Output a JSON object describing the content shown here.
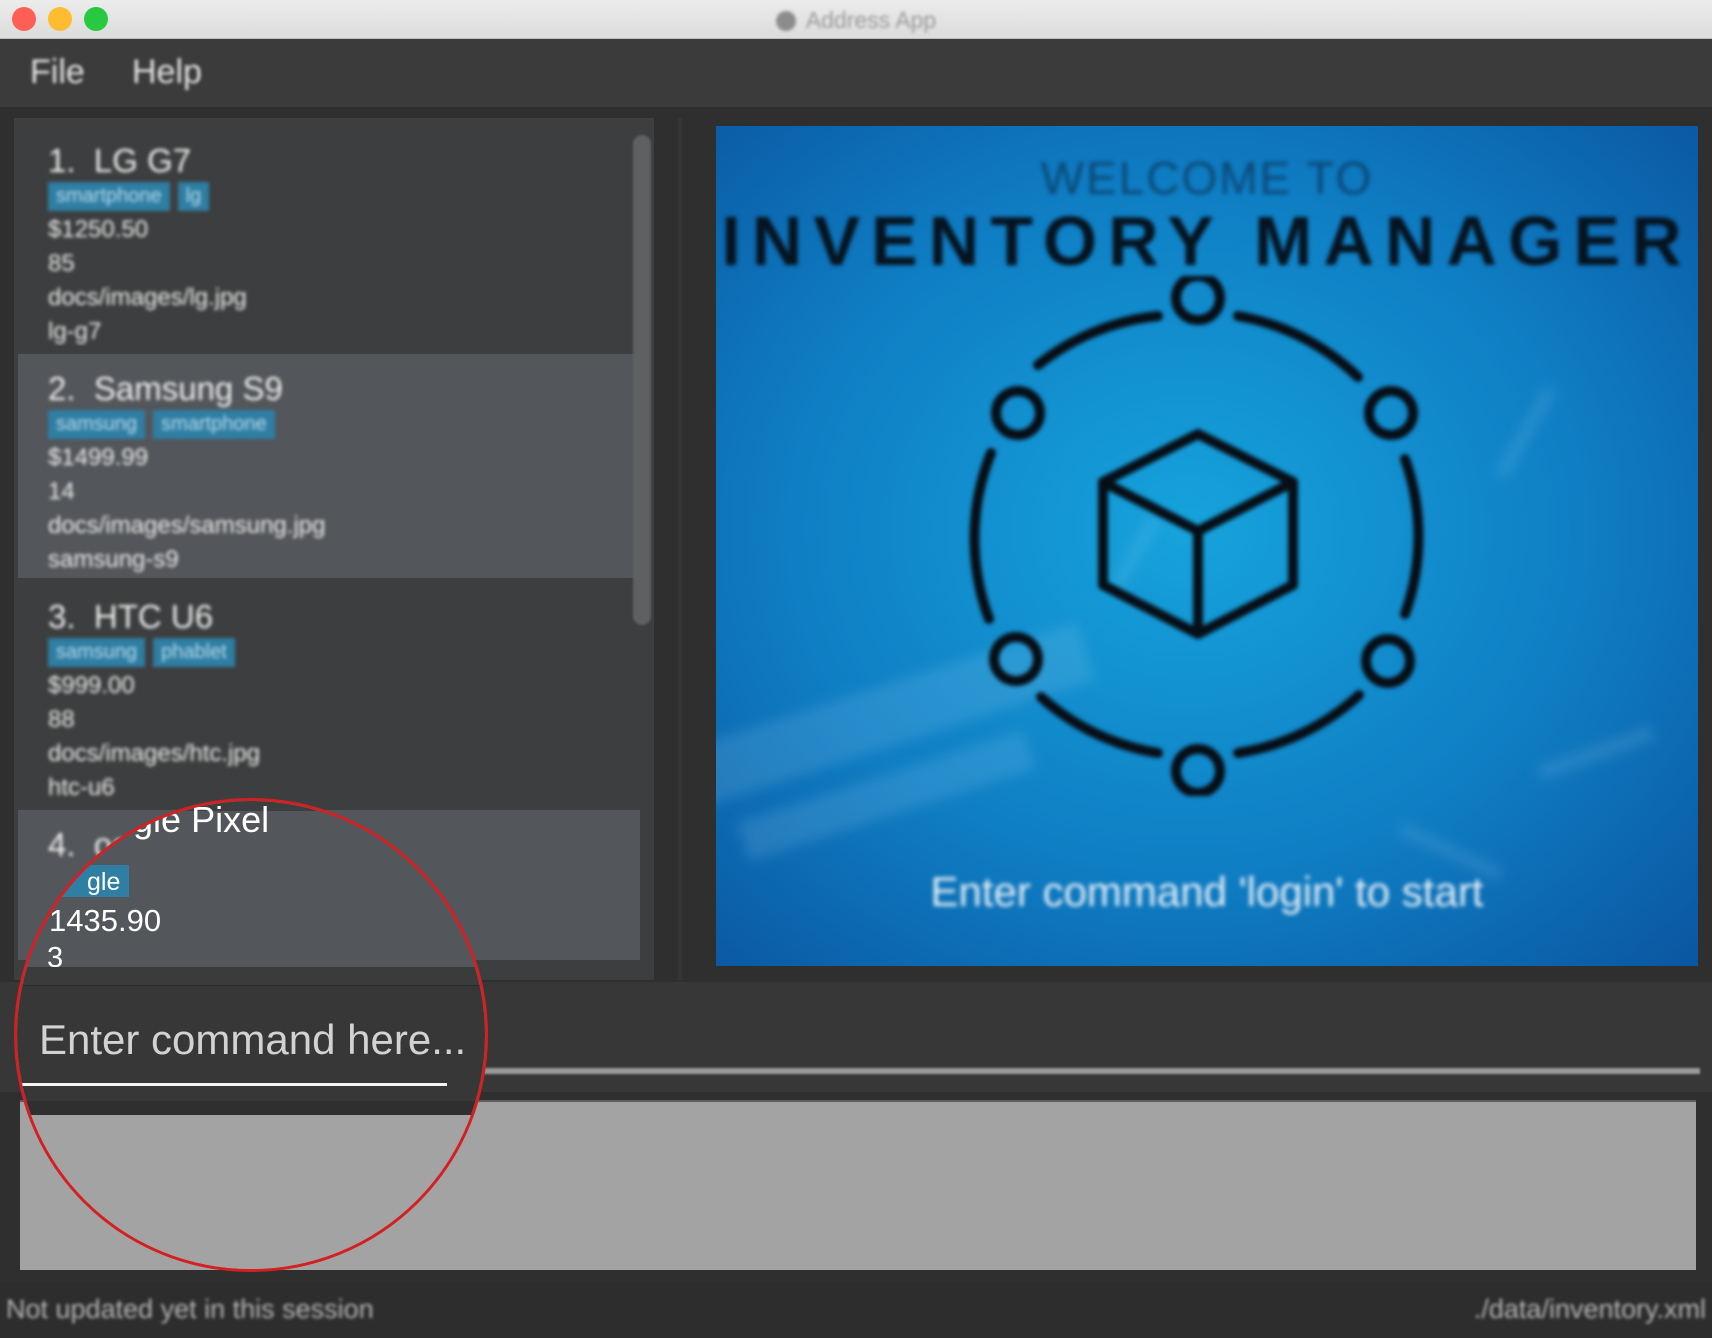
{
  "window": {
    "title": "Address App",
    "controls": {
      "close_color": "#fd5f57",
      "minimize_color": "#febc2e",
      "zoom_color": "#28c840"
    }
  },
  "menu": {
    "items": [
      "File",
      "Help"
    ]
  },
  "items": [
    {
      "index": "1.",
      "name": "LG G7",
      "tags": [
        "smartphone",
        "lg"
      ],
      "price": "$1250.50",
      "quantity": "85",
      "image": "docs/images/lg.jpg",
      "sku": "lg-g7"
    },
    {
      "index": "2.",
      "name": "Samsung S9",
      "tags": [
        "samsung",
        "smartphone"
      ],
      "price": "$1499.99",
      "quantity": "14",
      "image": "docs/images/samsung.jpg",
      "sku": "samsung-s9"
    },
    {
      "index": "3.",
      "name": "HTC U6",
      "tags": [
        "samsung",
        "phablet"
      ],
      "price": "$999.00",
      "quantity": "88",
      "image": "docs/images/htc.jpg",
      "sku": "htc-u6"
    },
    {
      "index": "4.",
      "name_visible": "ogle Pixel",
      "tag_visible": "gle",
      "price_visible": "1435.90",
      "quantity": "3"
    }
  ],
  "splash": {
    "welcome": "WELCOME TO",
    "heading": "INVENTORY MANAGER",
    "hint": "Enter command 'login' to start"
  },
  "command": {
    "placeholder": "Enter command here..."
  },
  "status": {
    "left": "Not updated yet in this session",
    "right": "./data/inventory.xml"
  },
  "colors": {
    "tag_bg": "#2f7ea3",
    "splash_blue": "#1591d3",
    "magnifier_ring": "#d41f23",
    "selected_row": "#53565a"
  }
}
